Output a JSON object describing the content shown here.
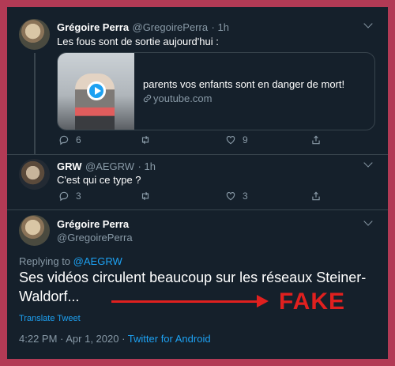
{
  "tweet1": {
    "name": "Grégoire Perra",
    "handle": "@GregoirePerra",
    "time": "· 1h",
    "text": "Les fous sont de sortie aujourd'hui :",
    "card": {
      "title": "parents vos enfants sont en danger de mort!",
      "domain": "youtube.com"
    },
    "actions": {
      "replies": "6",
      "retweets": "",
      "likes": "9"
    }
  },
  "tweet2": {
    "name": "GRW",
    "handle": "@AEGRW",
    "time": "· 1h",
    "text": "C'est qui ce type ?",
    "actions": {
      "replies": "3",
      "retweets": "",
      "likes": "3"
    }
  },
  "main": {
    "name": "Grégoire Perra",
    "handle": "@GregoirePerra",
    "replying_to_label": "Replying to",
    "replying_to_handle": "@AEGRW",
    "text_line1": "Ses vidéos circulent beaucoup sur les réseaux Steiner-",
    "text_line2": "Waldorf...",
    "translate": "Translate Tweet",
    "timestamp": "4:22 PM · Apr 1, 2020 ·",
    "source": "Twitter for Android"
  },
  "annotation": {
    "label": "FAKE",
    "color": "#e0201f"
  },
  "icons": {
    "reply": "reply-icon",
    "retweet": "retweet-icon",
    "like": "heart-icon",
    "share": "share-icon",
    "link": "link-icon",
    "play": "play-icon",
    "chevron": "chevron-down-icon"
  },
  "colors": {
    "background": "#15202b",
    "accent": "#1da1f2",
    "muted": "#8899a6",
    "border": "#b23a55"
  }
}
